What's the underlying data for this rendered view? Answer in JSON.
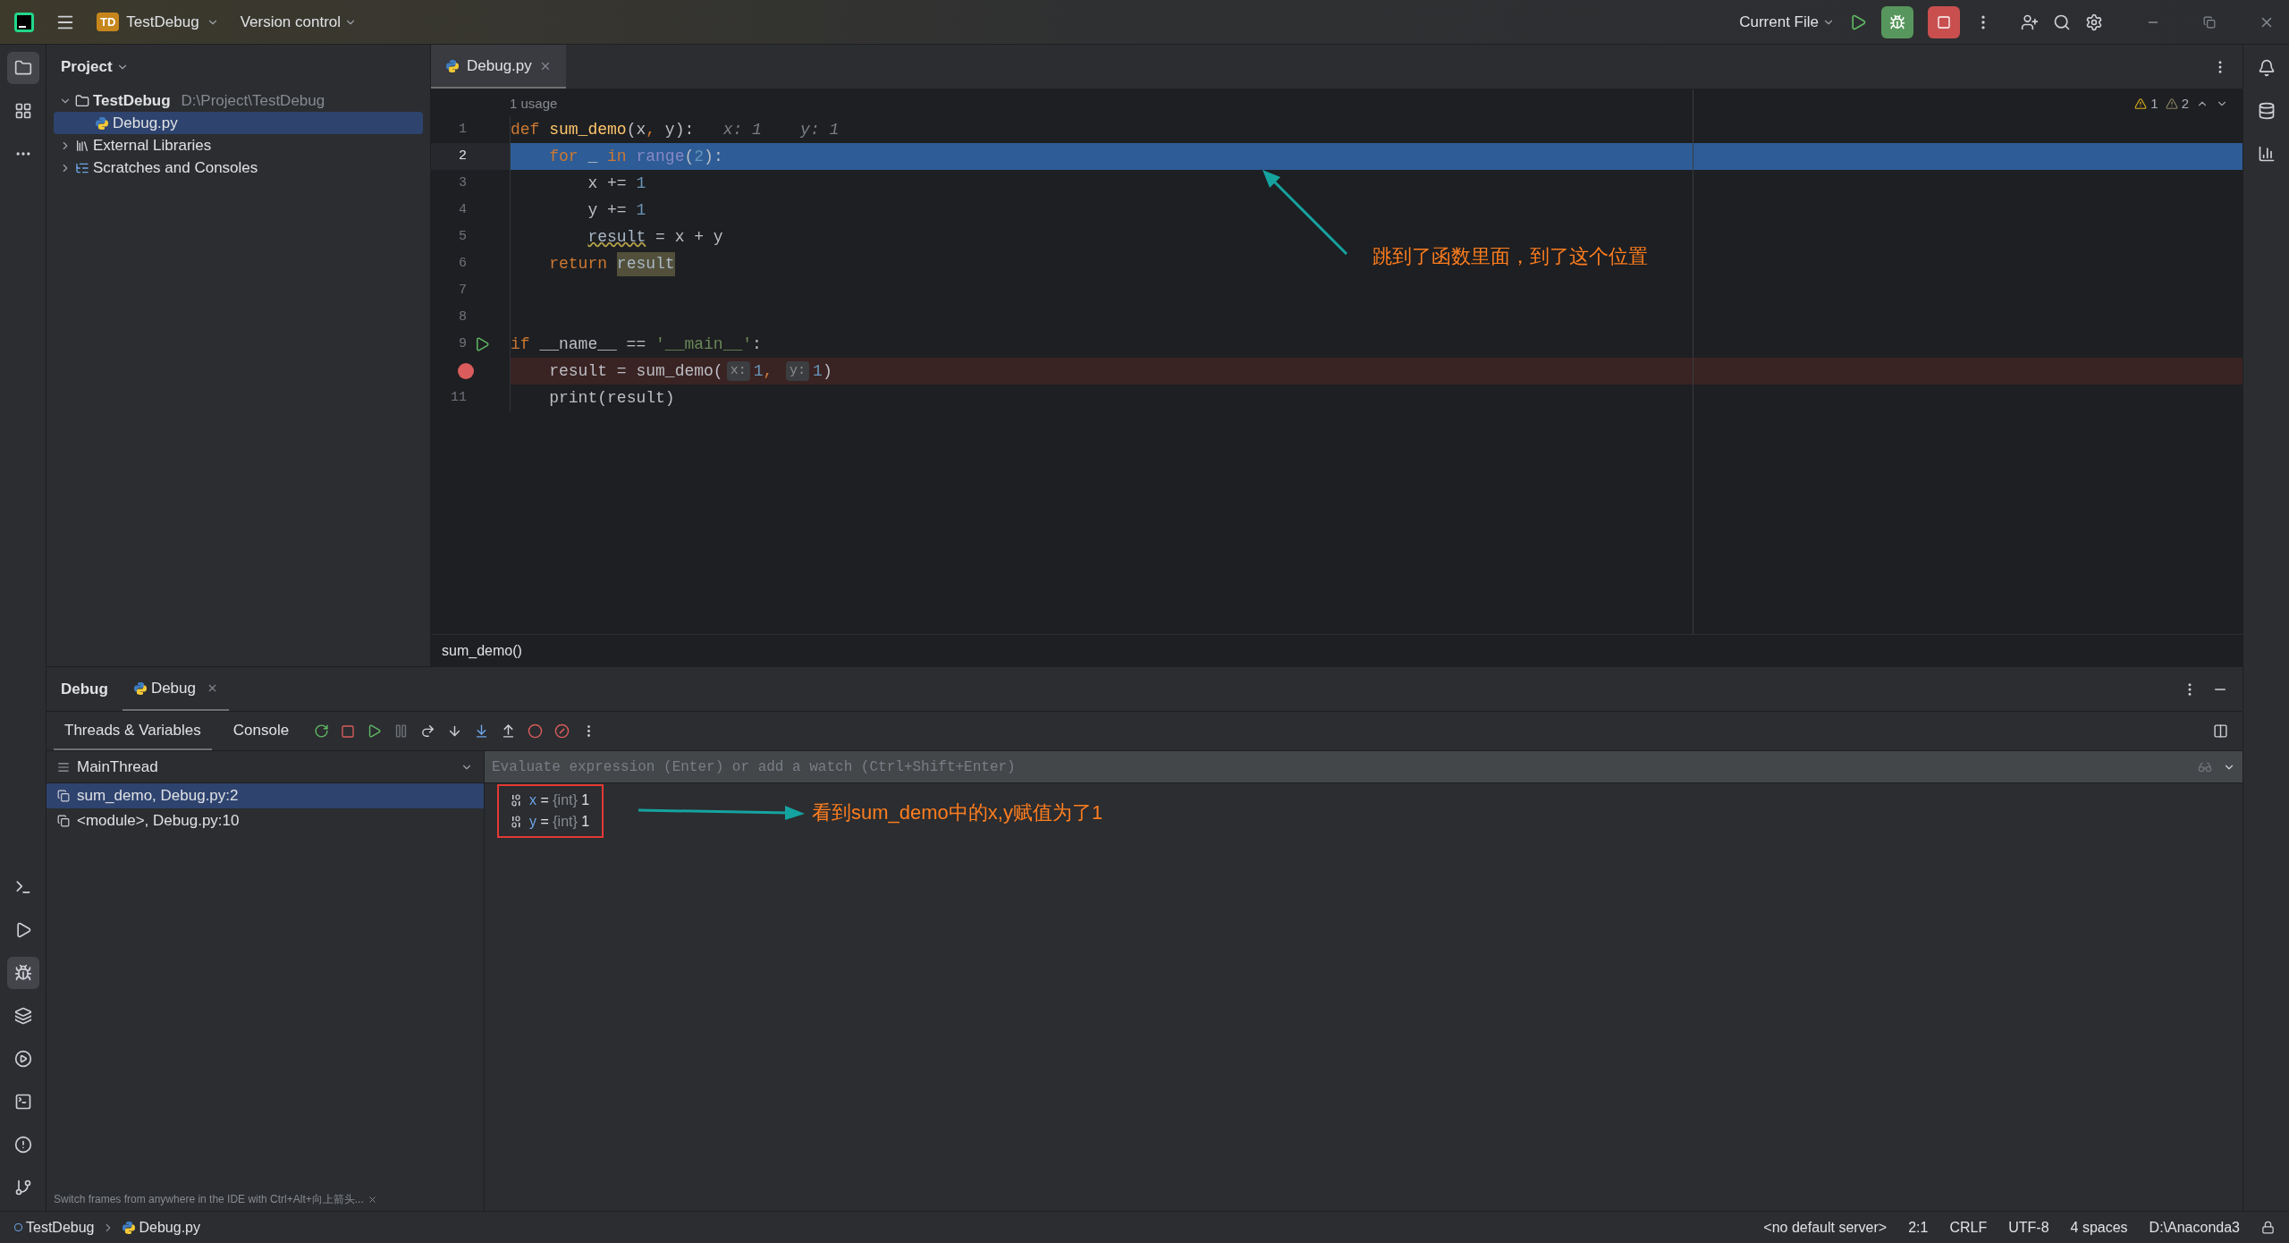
{
  "title_bar": {
    "project_badge": "TD",
    "project": "TestDebug",
    "vcs": "Version control",
    "run_config": "Current File"
  },
  "project_panel": {
    "title": "Project",
    "tree": [
      {
        "label": "TestDebug",
        "path": "D:\\Project\\TestDebug",
        "kind": "folder",
        "expanded": true,
        "selected": false,
        "children": [
          {
            "label": "Debug.py",
            "kind": "python",
            "selected": true
          }
        ]
      },
      {
        "label": "External Libraries",
        "kind": "library",
        "expanded": false,
        "selected": false
      },
      {
        "label": "Scratches and Consoles",
        "kind": "scratch",
        "expanded": false,
        "selected": false
      }
    ]
  },
  "editor": {
    "tabs": [
      {
        "label": "Debug.py",
        "selected": true
      }
    ],
    "usage_hint": "1 usage",
    "inspections": [
      {
        "kind": "warning",
        "count": "1"
      },
      {
        "kind": "weak",
        "count": "2"
      }
    ],
    "lines": [
      {
        "number": "1",
        "current": false,
        "breakpoint": false,
        "run_marker": false,
        "tokens": [
          {
            "kind": "kw",
            "text": "def "
          },
          {
            "kind": "fn",
            "text": "sum_demo"
          },
          {
            "kind": "plain",
            "text": "(x"
          },
          {
            "kind": "kw",
            "text": ", "
          },
          {
            "kind": "plain",
            "text": "y):"
          },
          {
            "kind": "hint",
            "text": "   x: 1    y: 1"
          }
        ]
      },
      {
        "number": "2",
        "current": true,
        "breakpoint": false,
        "run_marker": false,
        "tokens": [
          {
            "kind": "kw",
            "text": "    for "
          },
          {
            "kind": "plain",
            "text": "_ "
          },
          {
            "kind": "kw",
            "text": "in "
          },
          {
            "kind": "builtin",
            "text": "range"
          },
          {
            "kind": "plain",
            "text": "("
          },
          {
            "kind": "num",
            "text": "2"
          },
          {
            "kind": "plain",
            "text": "):"
          }
        ]
      },
      {
        "number": "3",
        "current": false,
        "breakpoint": false,
        "run_marker": false,
        "tokens": [
          {
            "kind": "plain",
            "text": "        x += "
          },
          {
            "kind": "num",
            "text": "1"
          }
        ]
      },
      {
        "number": "4",
        "current": false,
        "breakpoint": false,
        "run_marker": false,
        "tokens": [
          {
            "kind": "plain",
            "text": "        y += "
          },
          {
            "kind": "num",
            "text": "1"
          }
        ]
      },
      {
        "number": "5",
        "current": false,
        "breakpoint": false,
        "run_marker": false,
        "tokens": [
          {
            "kind": "warn",
            "text": "        result"
          },
          {
            "kind": "plain",
            "text": " = x + y"
          }
        ]
      },
      {
        "number": "6",
        "current": false,
        "breakpoint": false,
        "run_marker": false,
        "tokens": [
          {
            "kind": "kw",
            "text": "    return "
          },
          {
            "kind": "hl",
            "text": "result"
          }
        ]
      },
      {
        "number": "7",
        "current": false,
        "breakpoint": false,
        "run_marker": false
      },
      {
        "number": "8",
        "current": false,
        "breakpoint": false,
        "run_marker": false
      },
      {
        "number": "9",
        "current": false,
        "breakpoint": false,
        "run_marker": true,
        "tokens": [
          {
            "kind": "kw",
            "text": "if "
          },
          {
            "kind": "plain",
            "text": "__name__ == "
          },
          {
            "kind": "str",
            "text": "'__main__'"
          },
          {
            "kind": "plain",
            "text": ":"
          }
        ]
      },
      {
        "current": false,
        "breakpoint": true,
        "run_marker": false,
        "tokens": [
          {
            "kind": "plain",
            "text": "    result = sum_demo("
          },
          {
            "kind": "inlay",
            "text": "x:"
          },
          {
            "kind": "num",
            "text": "1"
          },
          {
            "kind": "kw",
            "text": ", "
          },
          {
            "kind": "inlay",
            "text": "y:"
          },
          {
            "kind": "num",
            "text": "1"
          },
          {
            "kind": "plain",
            "text": ")"
          }
        ]
      },
      {
        "number": "11",
        "current": false,
        "breakpoint": false,
        "run_marker": false,
        "tokens": [
          {
            "kind": "plain",
            "text": "    print(result)"
          }
        ]
      }
    ],
    "breadcrumb": "sum_demo()",
    "annotation": "跳到了函数里面，到了这个位置"
  },
  "debug": {
    "title": "Debug",
    "tabs": [
      {
        "label": "Debug",
        "selected": true
      }
    ],
    "subtabs": [
      {
        "label": "Threads & Variables",
        "selected": true
      },
      {
        "label": "Console",
        "selected": false
      }
    ],
    "thread": "MainThread",
    "frames": [
      {
        "label": "sum_demo, Debug.py:2",
        "selected": true
      },
      {
        "label": "<module>, Debug.py:10",
        "selected": false
      }
    ],
    "evaluate_placeholder": "Evaluate expression (Enter) or add a watch (Ctrl+Shift+Enter)",
    "variables": [
      {
        "name": "x",
        "sign": "=",
        "type": "{int}",
        "value": "1"
      },
      {
        "name": "y",
        "sign": "=",
        "type": "{int}",
        "value": "1"
      }
    ],
    "annotation": "看到sum_demo中的x,y赋值为了1",
    "tip": "Switch frames from anywhere in the IDE with Ctrl+Alt+向上箭头..."
  },
  "status_bar": {
    "breadcrumbs": [
      {
        "label": "TestDebug",
        "kind": "project"
      },
      {
        "label": "Debug.py",
        "kind": "python"
      }
    ],
    "items": [
      "<no default server>",
      "2:1",
      "CRLF",
      "UTF-8",
      "4 spaces",
      "D:\\Anaconda3"
    ]
  }
}
